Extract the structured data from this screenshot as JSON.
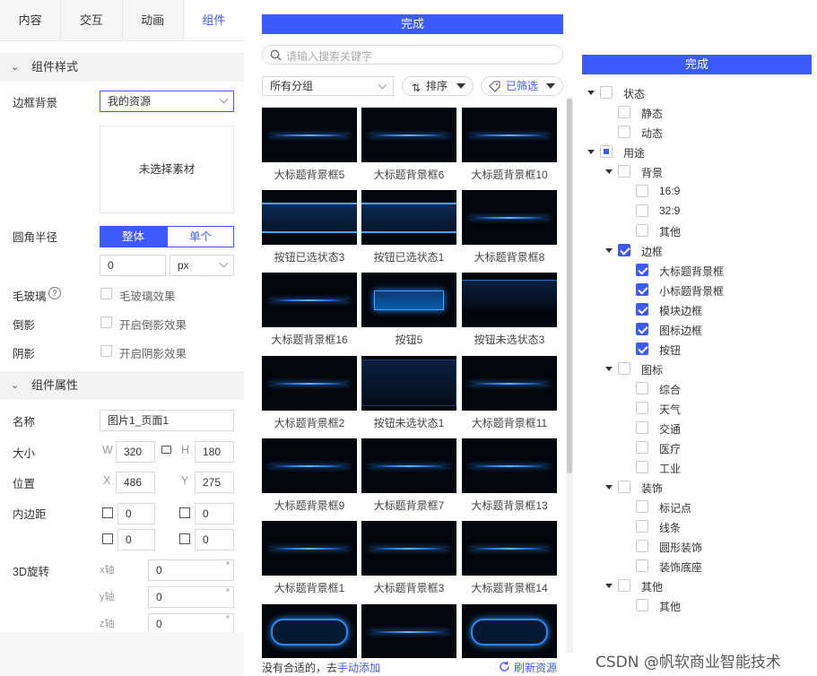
{
  "left": {
    "tabs": [
      "内容",
      "交互",
      "动画",
      "组件"
    ],
    "section_style": "组件样式",
    "border_bg_label": "边框背景",
    "border_bg_value": "我的资源",
    "no_material": "未选择素材",
    "radius_label": "圆角半径",
    "radius_whole": "整体",
    "radius_single": "单个",
    "radius_value": "0",
    "radius_unit": "px",
    "glass_label": "毛玻璃",
    "glass_check": "毛玻璃效果",
    "reflect_label": "倒影",
    "reflect_check": "开启倒影效果",
    "shadow_label": "阴影",
    "shadow_check": "开启阴影效果",
    "section_attr": "组件属性",
    "name_label": "名称",
    "name_value": "图片1_页面1",
    "size_label": "大小",
    "w_label": "W",
    "w_value": "320",
    "h_label": "H",
    "h_value": "180",
    "pos_label": "位置",
    "x_label": "X",
    "x_value": "486",
    "y_label": "Y",
    "y_value": "275",
    "padding_label": "内边距",
    "pad_top": "0",
    "pad_bottom": "0",
    "pad_left": "0",
    "pad_right": "0",
    "rotate_label": "3D旋转",
    "x_axis": "x轴",
    "y_axis": "y轴",
    "z_axis": "z轴",
    "rx": "0",
    "ry": "0",
    "rz": "0",
    "deg": "°"
  },
  "middle": {
    "done": "完成",
    "search_placeholder": "请输入搜索关键字",
    "group": "所有分组",
    "sort": "排序",
    "filtered": "已筛选",
    "captions": [
      "大标题背景框5",
      "大标题背景框6",
      "大标题背景框10",
      "按钮已选状态3",
      "按钮已选状态1",
      "大标题背景框8",
      "大标题背景框16",
      "按钮5",
      "按钮未选状态3",
      "大标题背景框2",
      "按钮未选状态1",
      "大标题背景框11",
      "大标题背景框9",
      "大标题背景框7",
      "大标题背景框13",
      "大标题背景框1",
      "大标题背景框3",
      "大标题背景框14"
    ],
    "footer_text": "没有合适的，去",
    "footer_link": "手动添加",
    "refresh": "刷新资源"
  },
  "right": {
    "done": "完成",
    "tree": {
      "status": "状态",
      "static": "静态",
      "dynamic": "动态",
      "usage": "用途",
      "background": "背景",
      "r169": "16:9",
      "r329": "32:9",
      "other1": "其他",
      "border": "边框",
      "big_title": "大标题背景框",
      "small_title": "小标题背景框",
      "module": "模块边框",
      "icon_border": "图标边框",
      "button": "按钮",
      "icon": "图标",
      "general": "综合",
      "weather": "天气",
      "traffic": "交通",
      "medical": "医疗",
      "industry": "工业",
      "decor": "装饰",
      "marker": "标记点",
      "lines": "线条",
      "round": "圆形装饰",
      "base": "装饰底座",
      "other": "其他",
      "other2": "其他"
    }
  },
  "watermark": "CSDN @帆软商业智能技术",
  "colors": {
    "accent": "#3d5afe",
    "thumb_bg": "#03060c",
    "glow": "#2a8cff"
  }
}
